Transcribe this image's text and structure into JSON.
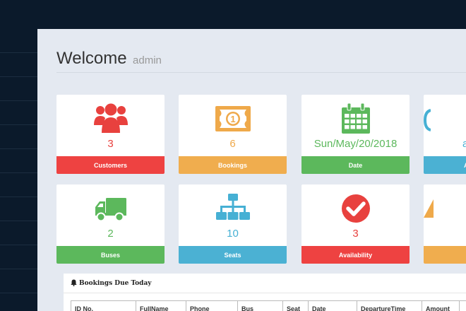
{
  "welcome": {
    "greeting": "Welcome",
    "username": "admin"
  },
  "stats_row1": [
    {
      "value": "3",
      "label": "Customers",
      "icon": "users-icon",
      "color": "#ee4241"
    },
    {
      "value": "6",
      "label": "Bookings",
      "icon": "money-icon",
      "color": "#f0ad4e"
    },
    {
      "value": "Sun/May/20/2018",
      "label": "Date",
      "icon": "calendar-icon",
      "color": "#5cb85c"
    },
    {
      "value": "a",
      "label": "A",
      "icon": "partial-icon",
      "color": "#4bb1d3"
    }
  ],
  "stats_row2": [
    {
      "value": "2",
      "label": "Buses",
      "icon": "truck-icon",
      "color": "#5cb85c"
    },
    {
      "value": "10",
      "label": "Seats",
      "icon": "sitemap-icon",
      "color": "#4bb1d3"
    },
    {
      "value": "3",
      "label": "Availability",
      "icon": "check-circle-icon",
      "color": "#ee4241"
    },
    {
      "value": "",
      "label": "",
      "icon": "warning-icon",
      "color": "#f0ad4e"
    }
  ],
  "bookings_panel": {
    "title": "Bookings Due Today",
    "icon": "bell-icon",
    "columns": [
      "ID No.",
      "FullName",
      "Phone",
      "Bus",
      "Seat",
      "Date",
      "DepartureTime",
      "Amount",
      ""
    ]
  }
}
